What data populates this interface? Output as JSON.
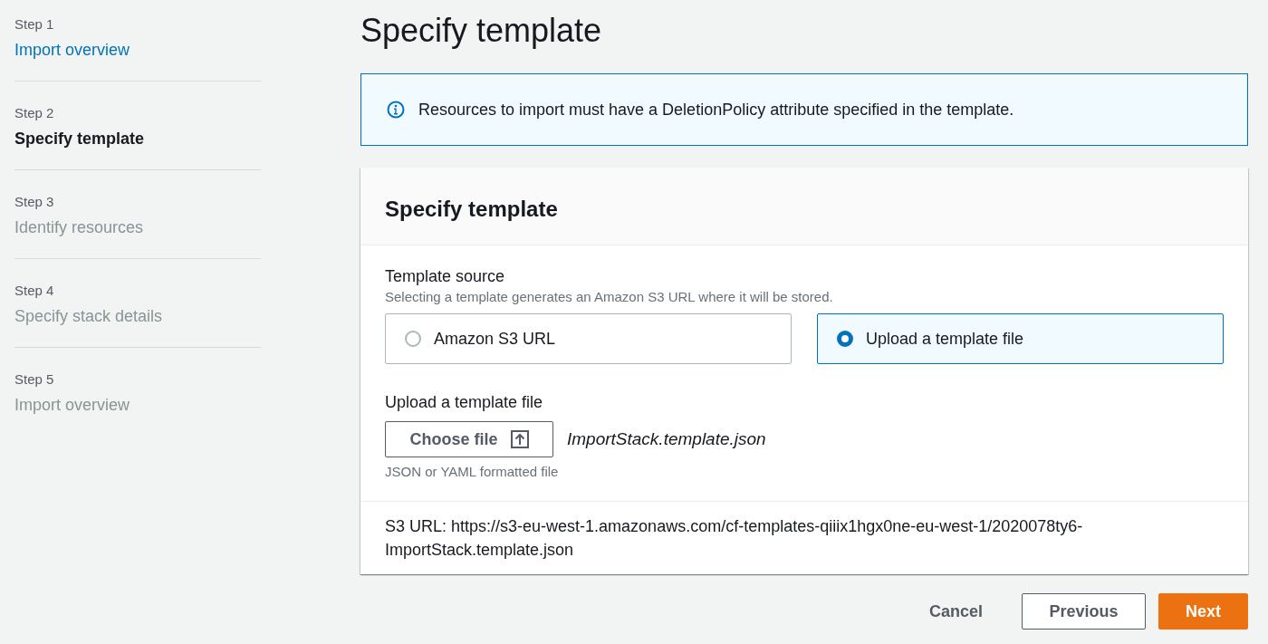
{
  "navigation": {
    "steps": [
      {
        "step": "Step 1",
        "title": "Import overview",
        "selected": false,
        "disabled": false
      },
      {
        "step": "Step 2",
        "title": "Specify template",
        "selected": true,
        "disabled": false
      },
      {
        "step": "Step 3",
        "title": "Identify resources",
        "selected": false,
        "disabled": true
      },
      {
        "step": "Step 4",
        "title": "Specify stack details",
        "selected": false,
        "disabled": true
      },
      {
        "step": "Step 5",
        "title": "Import overview",
        "selected": false,
        "disabled": true
      }
    ]
  },
  "page_title": "Specify template",
  "alert": {
    "message": "Resources to import must have a DeletionPolicy attribute specified in the template."
  },
  "panel": {
    "title": "Specify template",
    "template_source": {
      "label": "Template source",
      "description": "Selecting a template generates an Amazon S3 URL where it will be stored.",
      "options": [
        {
          "label": "Amazon S3 URL",
          "selected": false
        },
        {
          "label": "Upload a template file",
          "selected": true
        }
      ]
    },
    "upload": {
      "label": "Upload a template file",
      "button": "Choose file",
      "file_name": "ImportStack.template.json",
      "hint": "JSON or YAML formatted file"
    },
    "s3_url": "S3 URL: https://s3-eu-west-1.amazonaws.com/cf-templates-qiiix1hgx0ne-eu-west-1/2020078ty6-ImportStack.template.json"
  },
  "actions": [
    {
      "label": "Cancel",
      "kind": "link"
    },
    {
      "label": "Previous",
      "kind": "normal"
    },
    {
      "label": "Next",
      "kind": "primary"
    }
  ]
}
